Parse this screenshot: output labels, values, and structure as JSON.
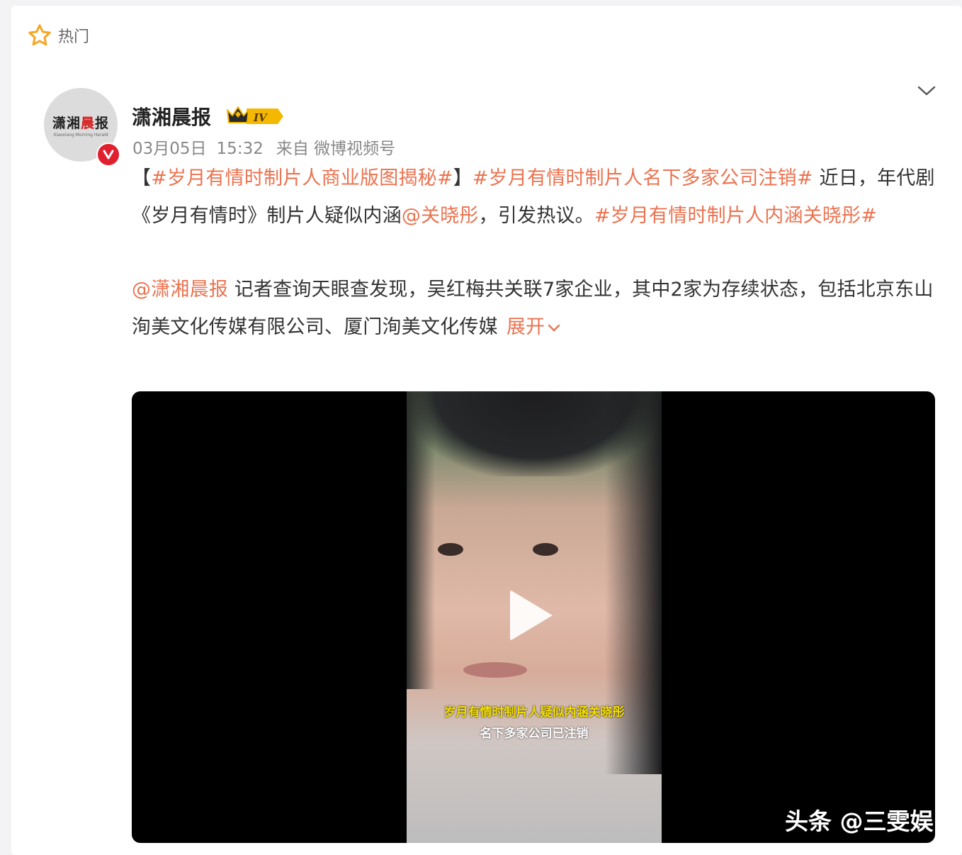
{
  "header": {
    "section_label": "热门",
    "icon": "star-icon"
  },
  "post": {
    "author": "潇湘晨报",
    "avatar_logo": "潇湘晨报",
    "avatar_logo_sub": "Xiaoxiang Morning Herald",
    "level_badge": "IV",
    "date": "03月05日",
    "time": "15:32",
    "source": "来自 微博视频号",
    "para1": {
      "bracket_open": "【",
      "tag1": "#岁月有情时制片人商业版图揭秘#",
      "bracket_close": "】",
      "tag2": "#岁月有情时制片人名下多家公司注销#",
      "text1": " 近日，年代剧《岁月有情时》制片人疑似内涵",
      "mention": "@关晓彤",
      "text2": "，引发热议。",
      "tag3": "#岁月有情时制片人内涵关晓彤#"
    },
    "para2": {
      "mention": "@潇湘晨报",
      "text": " 记者查询天眼查发现，吴红梅共关联7家企业，其中2家为存续状态，包括北京东山洵美文化传媒有限公司、厦门洵美文化传媒",
      "expand_label": "展开"
    },
    "video": {
      "caption_line1": "岁月有情时制片人疑似内涵关晓彤",
      "caption_line2": "名下多家公司已注销"
    }
  },
  "watermark": "头条 @三雯娱",
  "colors": {
    "accent": "#eb7350",
    "verified": "#e0202f",
    "badge": "#f5b800"
  }
}
